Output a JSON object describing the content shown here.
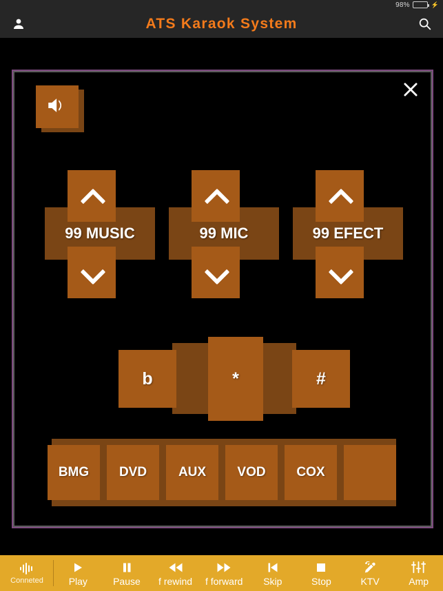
{
  "status_bar": {
    "battery_percent": "98%",
    "battery_level": 98,
    "battery_color": "#4cd362",
    "charging_icon": "lightning-bolt-icon"
  },
  "header": {
    "title": "ATS  Karaok  System",
    "title_color": "#F47B1B",
    "background": "#262626",
    "left_icon": "user-icon",
    "right_icon": "search-icon"
  },
  "panel": {
    "border_color": "#7E4B80",
    "inner_border_color": "#5c5c5c",
    "close_icon": "close-icon",
    "speaker_icon": "speaker-volume-icon",
    "button_face_color": "#A55A18",
    "button_shadow_color": "#7A4515",
    "volume_controls": [
      {
        "label": "99 MUSIC",
        "up_icon": "chevron-up-icon",
        "down_icon": "chevron-down-icon"
      },
      {
        "label": "99 MIC",
        "up_icon": "chevron-up-icon",
        "down_icon": "chevron-down-icon"
      },
      {
        "label": "99 EFECT",
        "up_icon": "chevron-up-icon",
        "down_icon": "chevron-down-icon"
      }
    ],
    "symbol_buttons": [
      {
        "label": "b"
      },
      {
        "label": "*"
      },
      {
        "label": "#"
      }
    ],
    "source_buttons": [
      {
        "label": "BMG"
      },
      {
        "label": "DVD"
      },
      {
        "label": "AUX"
      },
      {
        "label": "VOD"
      },
      {
        "label": "COX"
      },
      {
        "label": ""
      }
    ]
  },
  "toolbar": {
    "background": "#E3A929",
    "items": [
      {
        "label": "Conneted",
        "icon": "waveform-icon"
      },
      {
        "label": "Play",
        "icon": "play-icon"
      },
      {
        "label": "Pause",
        "icon": "pause-icon"
      },
      {
        "label": "f rewind",
        "icon": "rewind-icon"
      },
      {
        "label": "f forward",
        "icon": "fast-forward-icon"
      },
      {
        "label": "Skip",
        "icon": "skip-previous-icon"
      },
      {
        "label": "Stop",
        "icon": "stop-icon"
      },
      {
        "label": "KTV",
        "icon": "microphone-music-icon"
      },
      {
        "label": "Amp",
        "icon": "equalizer-sliders-icon"
      }
    ]
  }
}
